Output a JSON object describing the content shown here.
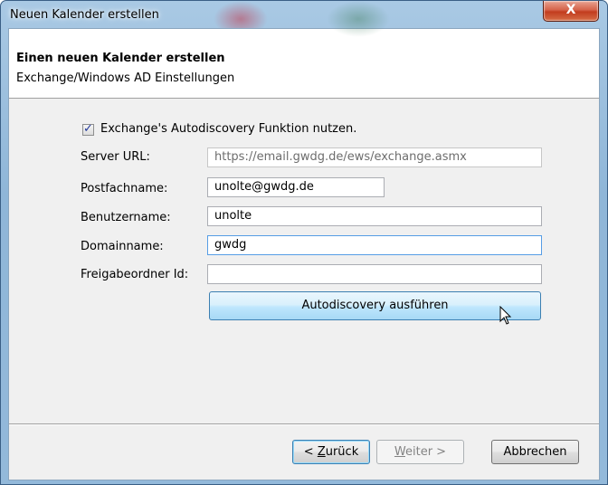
{
  "window": {
    "title": "Neuen Kalender erstellen",
    "close_label": "X"
  },
  "header": {
    "title": "Einen neuen Kalender erstellen",
    "subtitle": "Exchange/Windows AD Einstellungen"
  },
  "form": {
    "autodiscovery_checkbox": {
      "label": "Exchange's Autodiscovery Funktion nutzen.",
      "checked": true
    },
    "server_url": {
      "label": "Server URL:",
      "value": "https://email.gwdg.de/ews/exchange.asmx"
    },
    "postfachname": {
      "label": "Postfachname:",
      "value": "unolte@gwdg.de"
    },
    "benutzername": {
      "label": "Benutzername:",
      "value": "unolte"
    },
    "domainname": {
      "label": "Domainname:",
      "value": "gwdg"
    },
    "freigabeordner": {
      "label": "Freigabeordner Id:",
      "value": ""
    },
    "autodiscovery_button": "Autodiscovery ausführen"
  },
  "footer": {
    "back": {
      "prefix": "< ",
      "accel": "Z",
      "rest": "urück"
    },
    "next": {
      "accel": "W",
      "rest": "eiter >"
    },
    "cancel": "Abbrechen"
  },
  "colors": {
    "titlebar": "#a9c9e4",
    "close_button": "#c23c1e",
    "dialog_background": "#f0f0f0",
    "focus_button": "#bee6fd"
  },
  "icons": {
    "checkbox": "check-mark",
    "cursor": "mouse-pointer-arrow"
  }
}
